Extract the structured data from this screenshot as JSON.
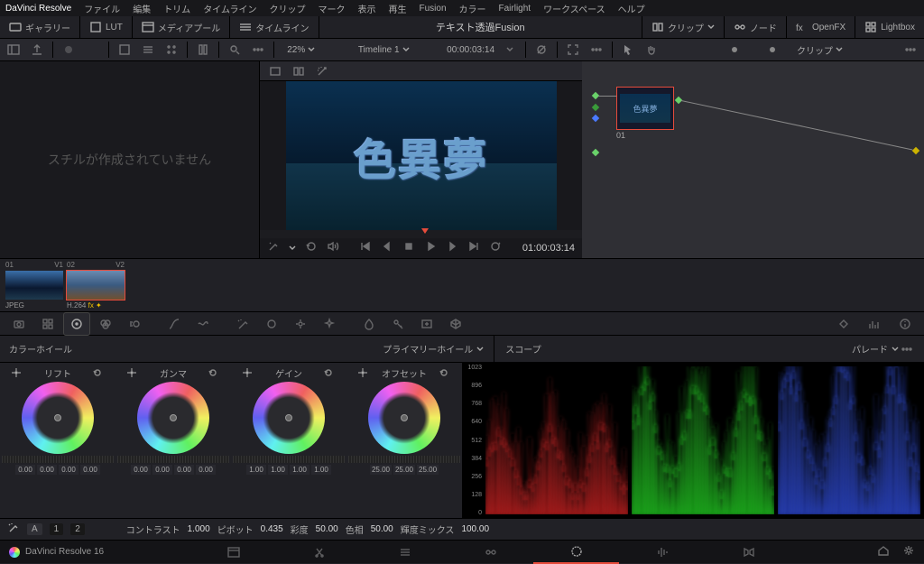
{
  "menu": {
    "app": "DaVinci Resolve",
    "items": [
      "ファイル",
      "編集",
      "トリム",
      "タイムライン",
      "クリップ",
      "マーク",
      "表示",
      "再生",
      "Fusion",
      "カラー",
      "Fairlight",
      "ワークスペース",
      "ヘルプ"
    ]
  },
  "uirow": {
    "gallery": "ギャラリー",
    "lut": "LUT",
    "mediapool": "メディアプール",
    "timeline": "タイムライン",
    "clips": "クリップ",
    "nodes": "ノード",
    "openfx": "OpenFX",
    "lightbox": "Lightbox"
  },
  "viewer": {
    "zoom": "22%",
    "timeline": "Timeline 1",
    "timecode_in": "00:00:03:14",
    "timecode_out": "01:00:03:14",
    "text3d": "色異夢"
  },
  "nodeview": {
    "clips_dd": "クリップ",
    "node_label": "01",
    "node_text": "色異夢"
  },
  "stills": {
    "empty": "スチルが作成されていません"
  },
  "clips": [
    {
      "id": "01",
      "track": "V1",
      "codec": "JPEG",
      "selected": false,
      "fx": false
    },
    {
      "id": "02",
      "track": "V2",
      "codec": "H.264",
      "selected": true,
      "fx": true
    }
  ],
  "wheels": {
    "title": "カラーホイール",
    "primaries": "プライマリーホイール",
    "cols": [
      {
        "label": "リフト",
        "nums": [
          "0.00",
          "0.00",
          "0.00",
          "0.00"
        ]
      },
      {
        "label": "ガンマ",
        "nums": [
          "0.00",
          "0.00",
          "0.00",
          "0.00"
        ]
      },
      {
        "label": "ゲイン",
        "nums": [
          "1.00",
          "1.00",
          "1.00",
          "1.00"
        ]
      },
      {
        "label": "オフセット",
        "nums": [
          "25.00",
          "25.00",
          "25.00"
        ]
      }
    ]
  },
  "scope": {
    "title": "スコープ",
    "mode": "パレード",
    "ticks": [
      "1023",
      "896",
      "768",
      "640",
      "512",
      "384",
      "256",
      "128",
      "0"
    ]
  },
  "adj": {
    "page_a": "A",
    "page_1": "1",
    "page_2": "2",
    "contrast_l": "コントラスト",
    "contrast": "1.000",
    "pivot_l": "ピボット",
    "pivot": "0.435",
    "sat_l": "彩度",
    "sat": "50.00",
    "hue_l": "色相",
    "hue": "50.00",
    "lummix_l": "輝度ミックス",
    "lummix": "100.00"
  },
  "pages": {
    "brand": "DaVinci Resolve 16"
  },
  "project_title": "テキスト透過Fusion"
}
